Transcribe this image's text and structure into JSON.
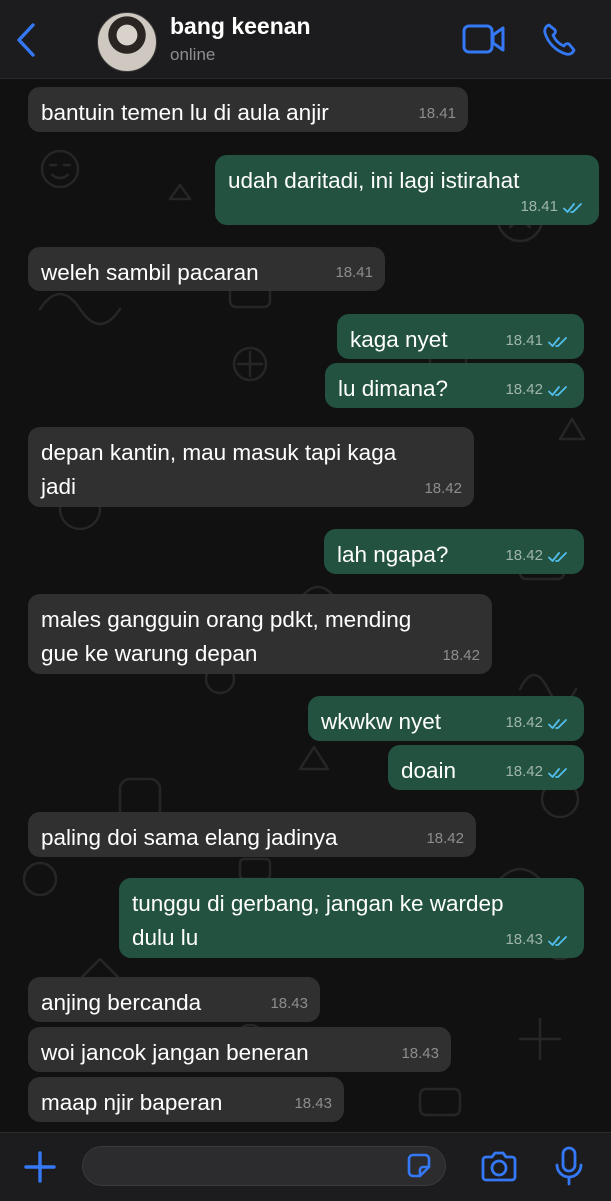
{
  "header": {
    "contact_name": "bang keenan",
    "status": "online",
    "icons": {
      "back": "chevron-left-icon",
      "video": "video-camera-icon",
      "call": "phone-icon"
    }
  },
  "colors": {
    "accent": "#3478f6",
    "incoming_bubble": "#303030",
    "outgoing_bubble": "#235340",
    "read_ticks": "#53bdeb",
    "background": "#111111"
  },
  "messages": [
    {
      "direction": "in",
      "lines": [
        "bantuin temen lu di aula anjir"
      ],
      "time": "18.41"
    },
    {
      "direction": "out",
      "lines": [
        "udah daritadi, ini lagi istirahat"
      ],
      "time": "18.41",
      "read": true
    },
    {
      "direction": "in",
      "lines": [
        "weleh sambil pacaran"
      ],
      "time": "18.41"
    },
    {
      "direction": "out",
      "lines": [
        "kaga nyet"
      ],
      "time": "18.41",
      "read": true
    },
    {
      "direction": "out",
      "lines": [
        "lu dimana?"
      ],
      "time": "18.42",
      "read": true
    },
    {
      "direction": "in",
      "lines": [
        "depan kantin, mau masuk tapi kaga",
        "jadi"
      ],
      "time": "18.42"
    },
    {
      "direction": "out",
      "lines": [
        "lah ngapa?"
      ],
      "time": "18.42",
      "read": true
    },
    {
      "direction": "in",
      "lines": [
        "males gangguin orang pdkt, mending",
        "gue ke warung depan"
      ],
      "time": "18.42"
    },
    {
      "direction": "out",
      "lines": [
        "wkwkw nyet"
      ],
      "time": "18.42",
      "read": true
    },
    {
      "direction": "out",
      "lines": [
        "doain"
      ],
      "time": "18.42",
      "read": true
    },
    {
      "direction": "in",
      "lines": [
        "paling doi sama elang jadinya"
      ],
      "time": "18.42"
    },
    {
      "direction": "out",
      "lines": [
        "tunggu di gerbang, jangan ke wardep",
        "dulu lu"
      ],
      "time": "18.43",
      "read": true
    },
    {
      "direction": "in",
      "lines": [
        "anjing bercanda"
      ],
      "time": "18.43"
    },
    {
      "direction": "in",
      "lines": [
        "woi jancok jangan beneran"
      ],
      "time": "18.43"
    },
    {
      "direction": "in",
      "lines": [
        "maap njir baperan"
      ],
      "time": "18.43"
    }
  ],
  "composer": {
    "value": "",
    "icons": {
      "attach": "plus-icon",
      "sticker": "sticker-icon",
      "camera": "camera-icon",
      "voice": "microphone-icon"
    }
  }
}
